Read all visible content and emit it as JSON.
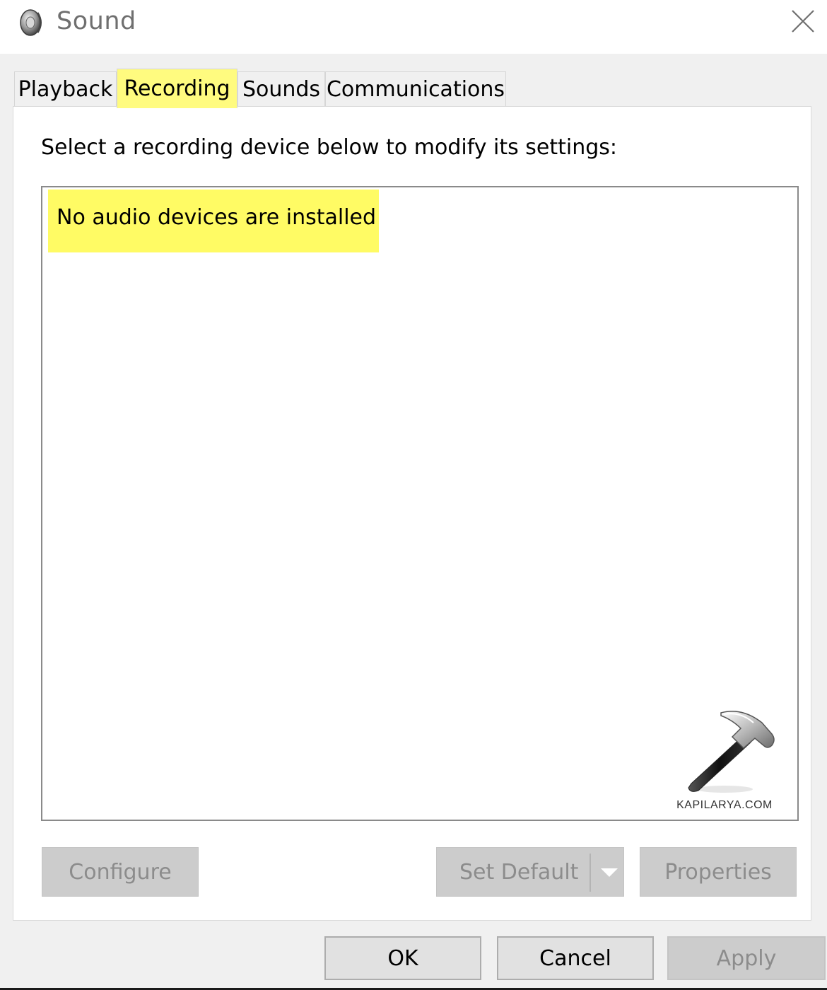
{
  "window": {
    "title": "Sound",
    "icon": "speaker-icon",
    "close_icon": "close-icon"
  },
  "tabs": [
    {
      "label": "Playback",
      "active": false
    },
    {
      "label": "Recording",
      "active": true
    },
    {
      "label": "Sounds",
      "active": false
    },
    {
      "label": "Communications",
      "active": false
    }
  ],
  "panel": {
    "instruction": "Select a recording device below to modify its settings:",
    "device_list": {
      "empty_message": "No audio devices are installed"
    },
    "watermark": {
      "icon": "hammer-icon",
      "text": "KAPILARYA.COM"
    },
    "buttons": {
      "configure": {
        "label": "Configure",
        "enabled": false
      },
      "set_default": {
        "label": "Set Default",
        "enabled": false,
        "dropdown_icon": "chevron-down-icon"
      },
      "properties": {
        "label": "Properties",
        "enabled": false
      }
    }
  },
  "dialog_buttons": {
    "ok": {
      "label": "OK",
      "enabled": true
    },
    "cancel": {
      "label": "Cancel",
      "enabled": true
    },
    "apply": {
      "label": "Apply",
      "enabled": false
    }
  },
  "colors": {
    "highlight": "#fffb64",
    "disabled_button": "#cccccc",
    "disabled_text": "#8c8c8c",
    "window_bg": "#f0f0f0"
  }
}
